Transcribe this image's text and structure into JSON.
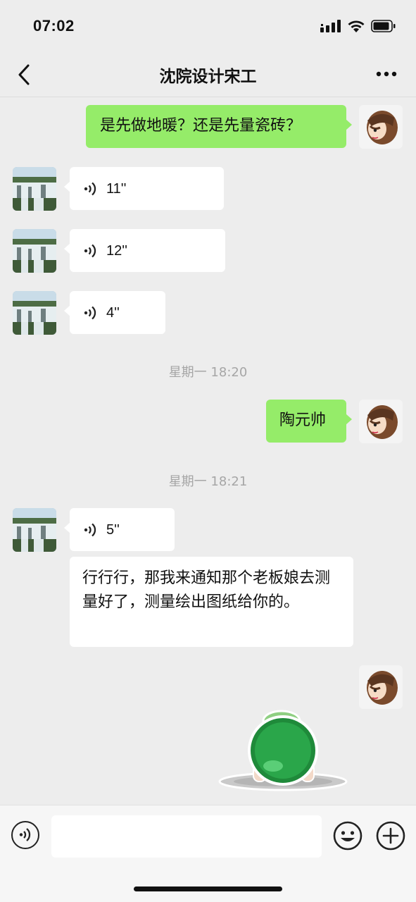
{
  "status": {
    "time": "07:02"
  },
  "header": {
    "title": "沈院设计宋工"
  },
  "messages": {
    "m1": {
      "text": "是先做地暖？还是先量瓷砖？"
    },
    "v1": {
      "duration": "11''"
    },
    "v2": {
      "duration": "12''"
    },
    "v3": {
      "duration": "4''"
    },
    "ts1": "星期一 18:20",
    "m2": {
      "text": "陶元帅"
    },
    "ts2": "星期一 18:21",
    "v4": {
      "duration": "5''"
    },
    "m3": {
      "text": "行行行，那我来通知那个老板娘去测量好了，测量绘出图纸给你的。"
    }
  },
  "colors": {
    "me_bubble": "#95ec69",
    "other_bubble": "#ffffff",
    "background": "#ededed"
  }
}
